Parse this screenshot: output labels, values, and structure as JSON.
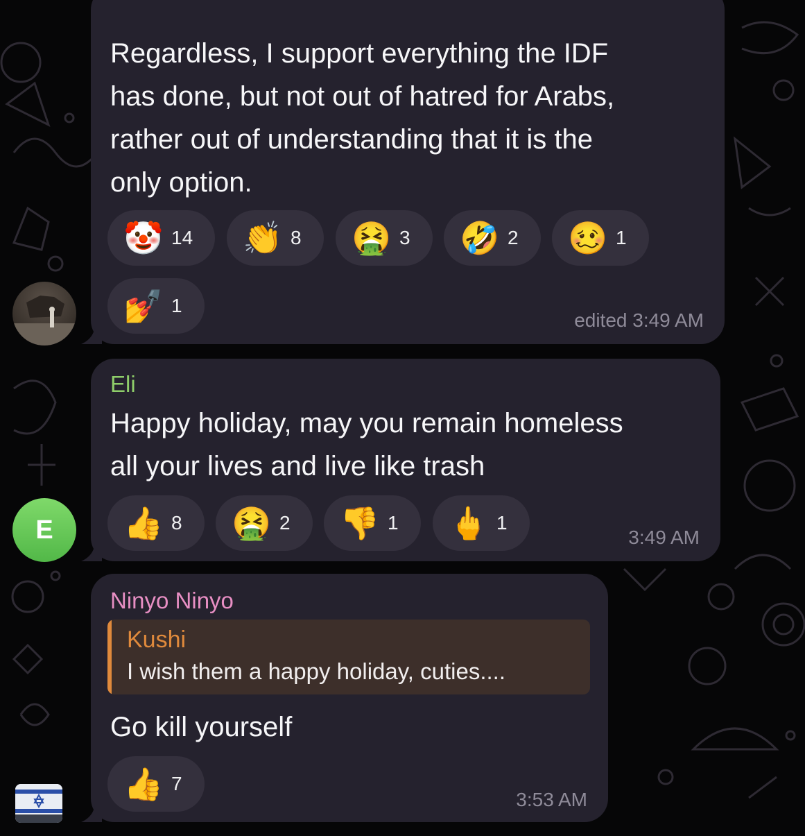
{
  "messages": [
    {
      "text": "Regardless, I support everything the IDF\nhas done, but not out of hatred for Arabs,\nrather out of understanding that it is the\nonly option.",
      "reactions": [
        {
          "emoji": "🤡",
          "icon": "clown-face-icon",
          "count": "14"
        },
        {
          "emoji": "👏",
          "icon": "clapping-hands-icon",
          "count": "8"
        },
        {
          "emoji": "🤮",
          "icon": "vomiting-face-icon",
          "count": "3"
        },
        {
          "emoji": "🤣",
          "icon": "rofl-face-icon",
          "count": "2"
        },
        {
          "emoji": "🥴",
          "icon": "woozy-face-icon",
          "count": "1"
        },
        {
          "emoji": "💅",
          "icon": "nail-polish-icon",
          "count": "1"
        }
      ],
      "time": "edited 3:49 AM"
    },
    {
      "sender": "Eli",
      "sender_color": "#8fce6a",
      "avatar_letter": "E",
      "avatar_color": "#6cc95a",
      "text": "Happy holiday, may you remain homeless\nall your lives and live like trash",
      "reactions": [
        {
          "emoji": "👍",
          "icon": "thumbs-up-icon",
          "count": "8"
        },
        {
          "emoji": "🤮",
          "icon": "vomiting-face-icon",
          "count": "2"
        },
        {
          "emoji": "👎",
          "icon": "thumbs-down-icon",
          "count": "1"
        },
        {
          "emoji": "🖕",
          "icon": "middle-finger-icon",
          "count": "1"
        }
      ],
      "time": "3:49 AM"
    },
    {
      "sender": "Ninyo Ninyo",
      "sender_color": "#e88fc4",
      "reply": {
        "name": "Kushi",
        "text": "I wish them a happy holiday, cuties...."
      },
      "text": "Go kill yourself",
      "reactions": [
        {
          "emoji": "👍",
          "icon": "thumbs-up-icon",
          "count": "7"
        }
      ],
      "time": "3:53 AM"
    }
  ]
}
